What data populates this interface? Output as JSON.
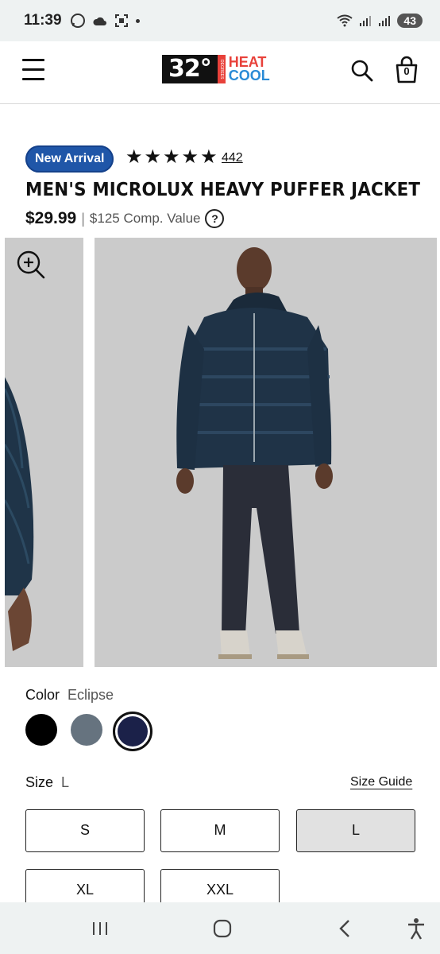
{
  "status_bar": {
    "time": "11:39",
    "battery": "43",
    "icons": [
      "whatsapp-icon",
      "cloud-icon",
      "screenshot-icon",
      "dot-icon",
      "wifi-icon",
      "signal-icon",
      "signal-icon"
    ]
  },
  "header": {
    "logo_number": "32°",
    "logo_side": "DEGREES",
    "logo_heat": "HEAT",
    "logo_cool": "COOL",
    "cart_count": "0",
    "colors": {
      "heat": "#e8413a",
      "cool": "#2a8bd6"
    }
  },
  "product": {
    "badge": "New Arrival",
    "rating": 5,
    "review_count": "442",
    "title": "MEN'S MICROLUX HEAVY PUFFER JACKET",
    "price": "$29.99",
    "separator": "|",
    "comp_value": "$125 Comp. Value",
    "help_icon": "?",
    "badge_color": "#1f56a8"
  },
  "color": {
    "label": "Color",
    "selected": "Eclipse",
    "swatches": [
      {
        "name": "black",
        "hex": "#000000"
      },
      {
        "name": "slate",
        "hex": "#66737f"
      },
      {
        "name": "eclipse",
        "hex": "#1b2149"
      }
    ]
  },
  "size": {
    "label": "Size",
    "selected": "L",
    "guide": "Size Guide",
    "options": [
      "S",
      "M",
      "L",
      "XL",
      "XXL"
    ]
  }
}
